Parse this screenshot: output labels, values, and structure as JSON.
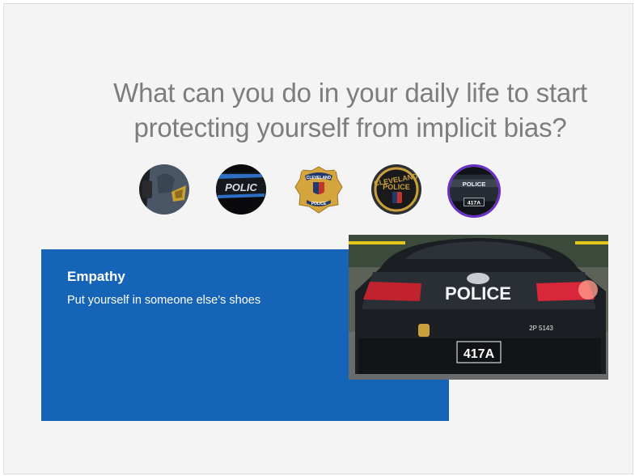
{
  "question": {
    "line1": "What can you do in your daily life to start",
    "line2": "protecting yourself from implicit bias?"
  },
  "thumbnails": [
    {
      "icon": "police-shoulder-patch-icon",
      "active": false
    },
    {
      "icon": "police-car-door-icon",
      "active": false
    },
    {
      "icon": "cleveland-police-badge-icon",
      "active": false
    },
    {
      "icon": "cleveland-police-patch-icon",
      "active": false
    },
    {
      "icon": "police-car-rear-icon",
      "active": true
    }
  ],
  "thumb_texts": {
    "door": "POLIC",
    "badge_top": "CLEVELAND",
    "badge_bottom": "POLICE",
    "patch_top": "CLEVELAND",
    "patch_bottom": "POLICE",
    "car_label": "POLICE",
    "car_plate": "417A"
  },
  "panel": {
    "title": "Empathy",
    "text": "Put yourself in someone else’s shoes"
  },
  "photo": {
    "rear_label": "POLICE",
    "car_number": "2P 5143",
    "plate": "417A"
  },
  "colors": {
    "panel": "#1664b8",
    "question_text": "#7d7d7d",
    "active_thumb_ring": "#6a2fc6",
    "slide_bg": "#f4f4f4"
  }
}
